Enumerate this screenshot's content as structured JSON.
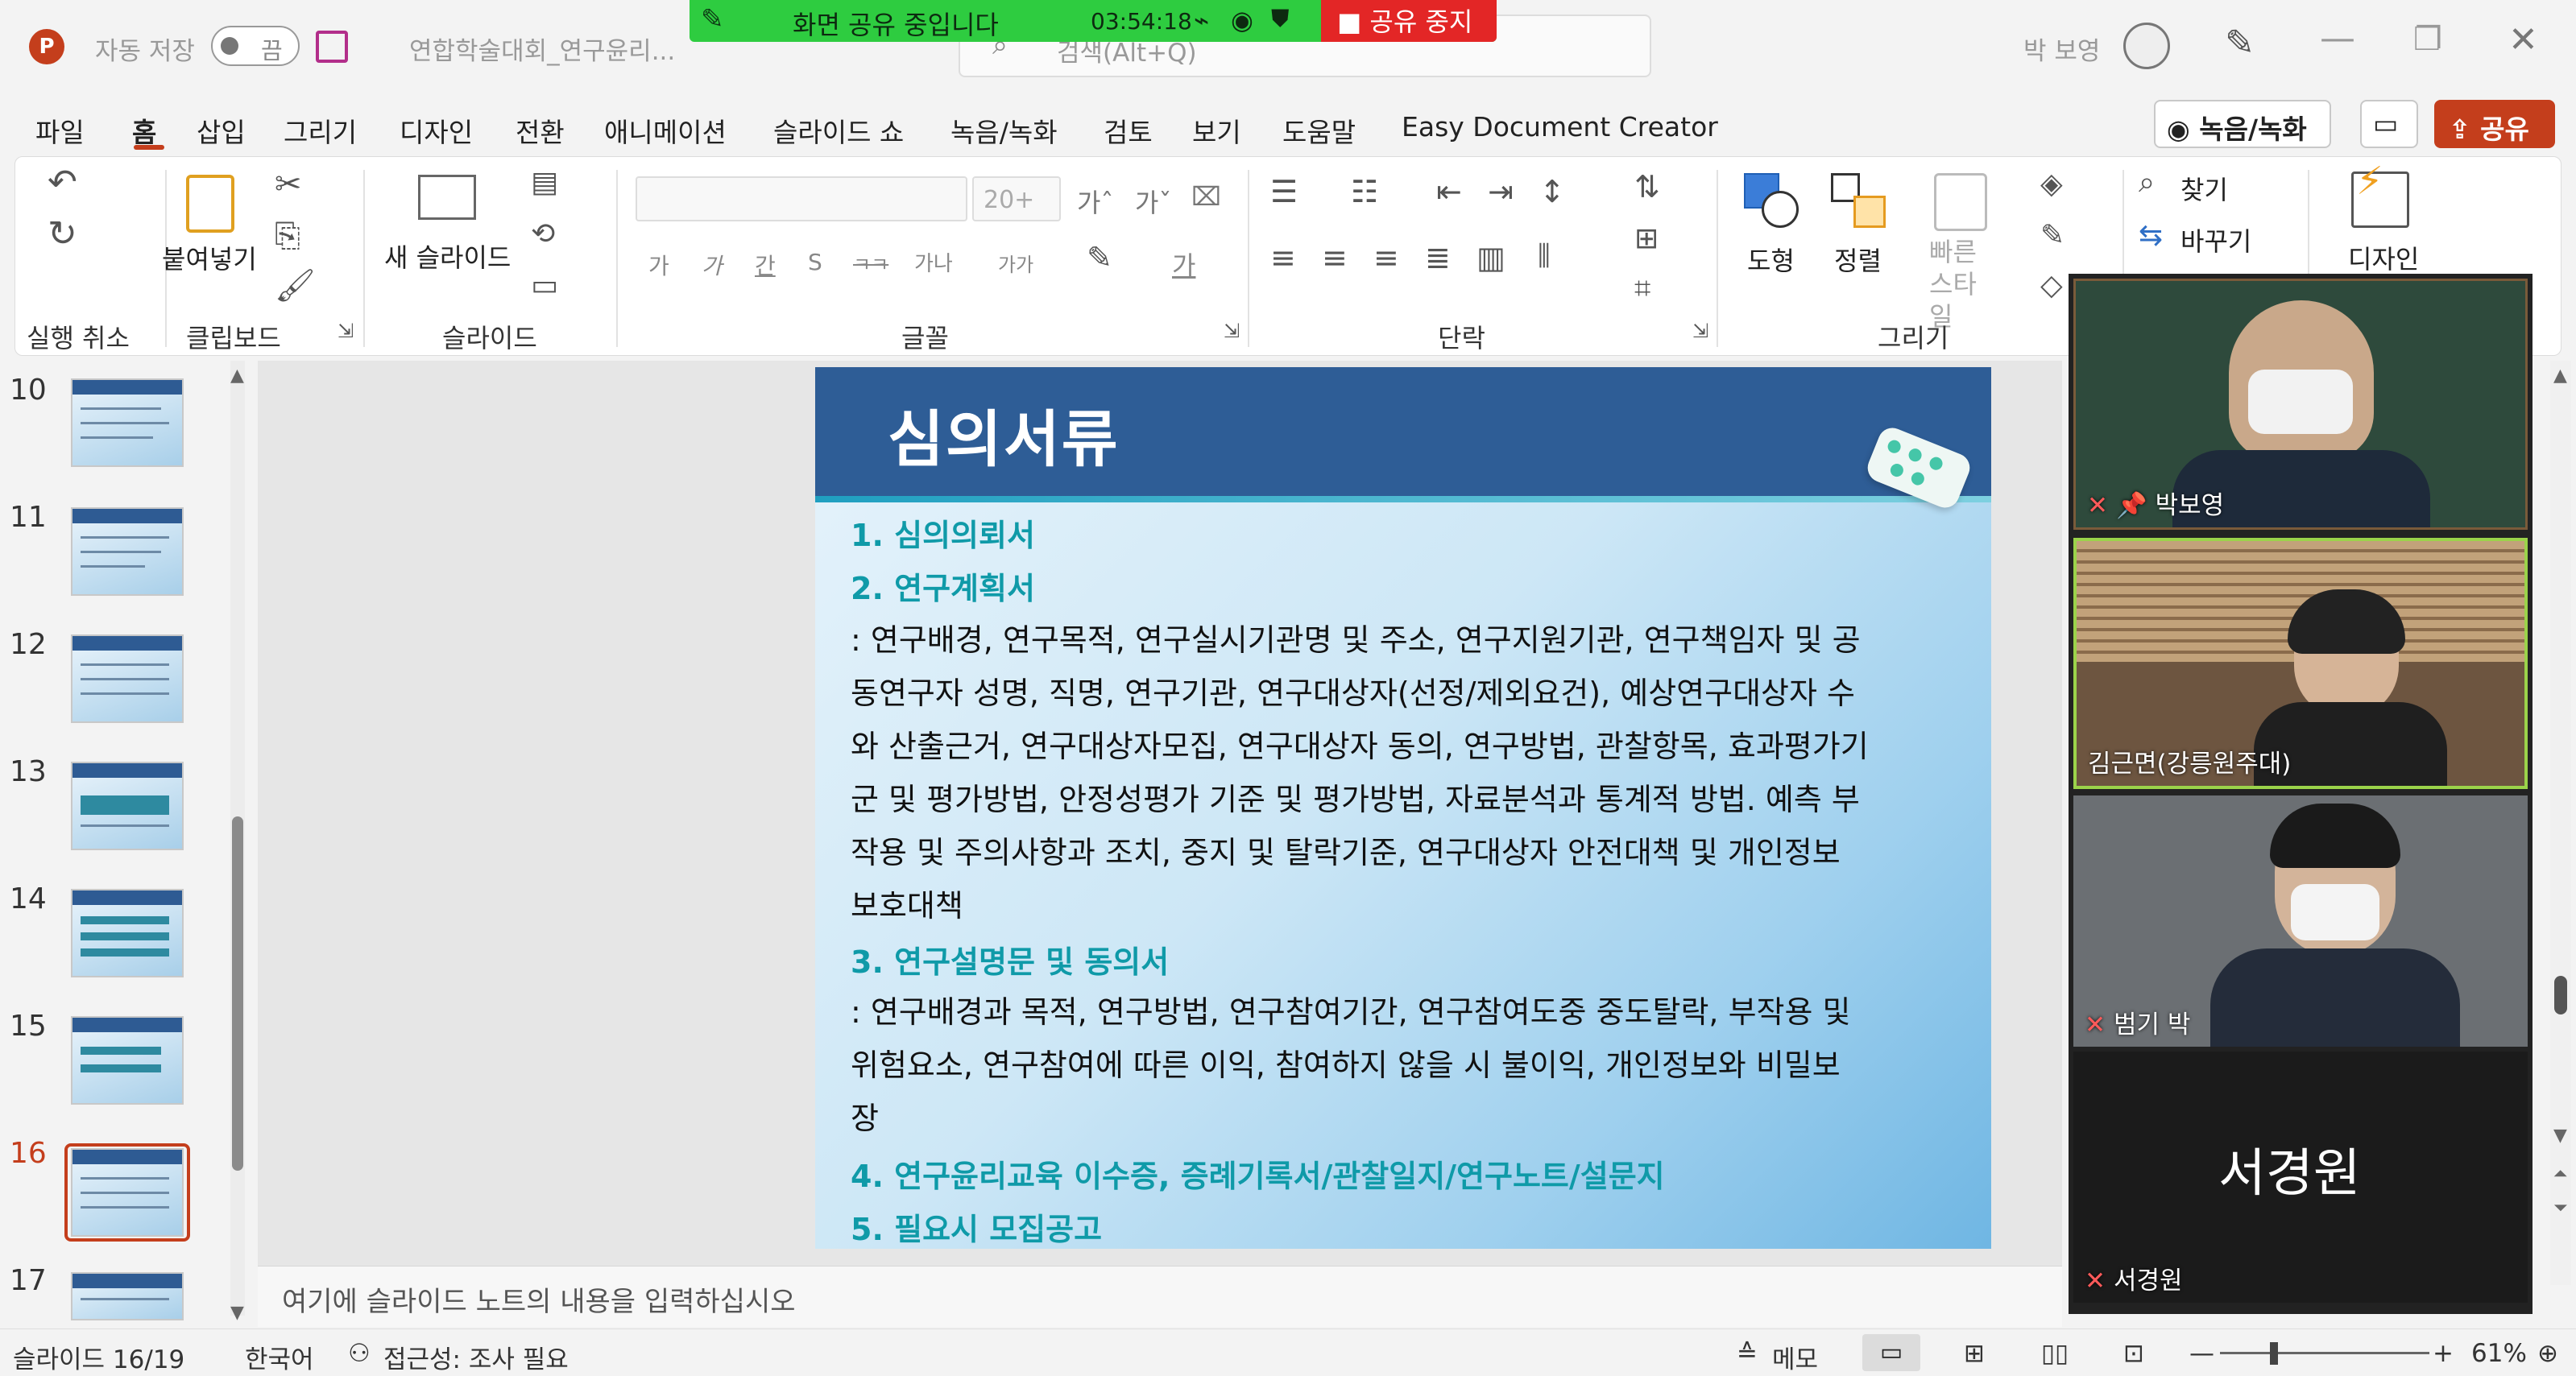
{
  "titlebar": {
    "autosave_label": "자동 저장",
    "autosave_state": "끔",
    "file_name": "연합학술대회_연구윤리...",
    "search_placeholder": "검색(Alt+Q)",
    "user_name": "박 보영"
  },
  "share_bar": {
    "status": "화면 공유 중입니다",
    "timer": "03:54:18",
    "stop_label": "공유 중지"
  },
  "menu": {
    "items": [
      "파일",
      "홈",
      "삽입",
      "그리기",
      "디자인",
      "전환",
      "애니메이션",
      "슬라이드 쇼",
      "녹음/녹화",
      "검토",
      "보기",
      "도움말",
      "Easy Document Creator"
    ],
    "active": "홈",
    "record_button": "녹음/녹화",
    "share_button": "공유"
  },
  "ribbon": {
    "groups": {
      "undo": "실행 취소",
      "clipboard": "클립보드",
      "slides": "슬라이드",
      "font": "글꼴",
      "paragraph": "단락",
      "drawing": "그리기"
    },
    "paste_label": "붙여넣기",
    "new_slide_label": "새 슬라이드",
    "font_size": "20+",
    "shape_label": "도형",
    "arrange_label": "정렬",
    "quick_style_label": "빠른 스타일",
    "find_label": "찾기",
    "replace_label": "바꾸기",
    "designer_label": "디자인",
    "font_buttons": [
      "가",
      "가",
      "간",
      "S",
      "ㅋㅋ",
      "가나",
      "가가"
    ],
    "font_grow": "가ˆ",
    "font_shrink": "가ˇ"
  },
  "thumbnails": {
    "numbers": [
      "10",
      "11",
      "12",
      "13",
      "14",
      "15",
      "16",
      "17"
    ],
    "selected": "16"
  },
  "slide": {
    "title": "심의서류",
    "items": [
      {
        "kind": "heading",
        "text": "1.  심의의뢰서"
      },
      {
        "kind": "heading",
        "text": "2.  연구계획서"
      },
      {
        "kind": "body",
        "text": " : 연구배경, 연구목적, 연구실시기관명 및 주소, 연구지원기관, 연구책임자 및 공"
      },
      {
        "kind": "body",
        "text": "동연구자 성명, 직명, 연구기관, 연구대상자(선정/제외요건), 예상연구대상자 수"
      },
      {
        "kind": "body",
        "text": "와 산출근거, 연구대상자모집, 연구대상자 동의, 연구방법, 관찰항목, 효과평가기"
      },
      {
        "kind": "body",
        "text": "군 및 평가방법, 안정성평가 기준 및 평가방법, 자료분석과 통계적 방법. 예측 부"
      },
      {
        "kind": "body",
        "text": "작용 및 주의사항과 조치, 중지 및 탈락기준, 연구대상자 안전대책 및 개인정보"
      },
      {
        "kind": "body",
        "text": "보호대책"
      },
      {
        "kind": "heading",
        "text": "3. 연구설명문 및 동의서"
      },
      {
        "kind": "body",
        "text": ": 연구배경과 목적, 연구방법, 연구참여기간, 연구참여도중 중도탈락, 부작용 및"
      },
      {
        "kind": "body",
        "text": "위험요소, 연구참여에 따른 이익, 참여하지 않을 시 불이익, 개인정보와 비밀보"
      },
      {
        "kind": "body",
        "text": "장"
      },
      {
        "kind": "heading",
        "text": "4. 연구윤리교육 이수증, 증례기록서/관찰일지/연구노트/설문지"
      },
      {
        "kind": "heading",
        "text": "5. 필요시 모집공고"
      }
    ]
  },
  "notes_placeholder": "여기에 슬라이드 노트의 내용을 입력하십시오",
  "video": {
    "participants": [
      {
        "name": "박보영",
        "pinned": true
      },
      {
        "name": "김근면(강릉원주대)",
        "pinned": false
      },
      {
        "name": "범기 박",
        "pinned": false
      },
      {
        "name": "서경원",
        "pinned": false
      }
    ],
    "big_name": "서경원"
  },
  "status": {
    "slide_pos": "슬라이드 16/19",
    "language": "한국어",
    "accessibility": "접근성: 조사 필요",
    "notes_btn": "메모",
    "zoom": "61%"
  },
  "colors": {
    "accent": "#c43e1c",
    "slide_header": "#2e5d96",
    "heading_teal": "#0f9aa8",
    "share_green": "#2ecc40",
    "stop_red": "#e32626"
  }
}
